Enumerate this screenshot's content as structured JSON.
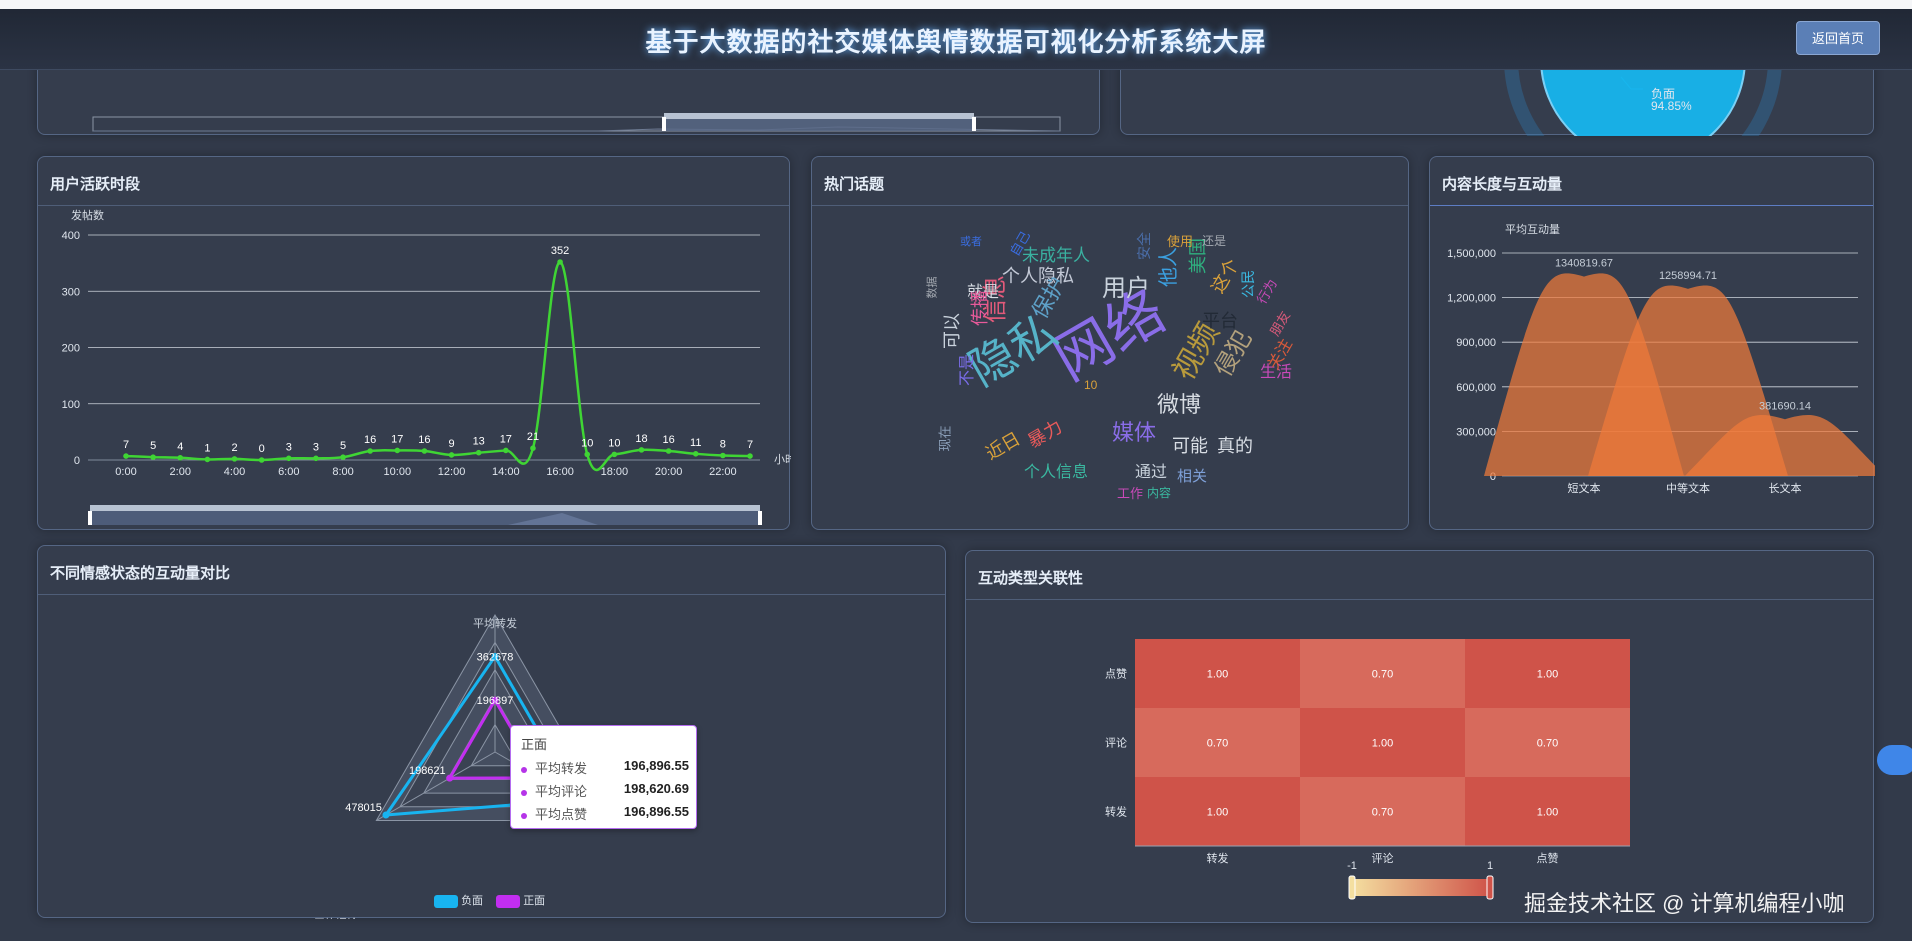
{
  "header": {
    "title": "基于大数据的社交媒体舆情数据可视化分析系统大屏",
    "home_button": "返回首页"
  },
  "sentiment_top": {
    "negative_label": "负面",
    "negative_value": "94.85%"
  },
  "activity_panel": {
    "title": "用户活跃时段",
    "chart_data": {
      "type": "line",
      "ylabel": "发帖数",
      "xlabel": "小时",
      "ylim": [
        0,
        400
      ],
      "yticks": [
        0,
        100,
        200,
        300,
        400
      ],
      "x": [
        "0:00",
        "1:00",
        "2:00",
        "3:00",
        "4:00",
        "5:00",
        "6:00",
        "7:00",
        "8:00",
        "9:00",
        "10:00",
        "11:00",
        "12:00",
        "13:00",
        "14:00",
        "15:00",
        "16:00",
        "17:00",
        "18:00",
        "19:00",
        "20:00",
        "21:00",
        "22:00",
        "23:00"
      ],
      "xtick_labels": [
        "0:00",
        "2:00",
        "4:00",
        "6:00",
        "8:00",
        "10:00",
        "12:00",
        "14:00",
        "16:00",
        "18:00",
        "20:00",
        "22:00"
      ],
      "values": [
        7,
        5,
        4,
        1,
        2,
        0,
        3,
        3,
        5,
        16,
        17,
        16,
        9,
        13,
        17,
        21,
        352,
        10,
        10,
        18,
        16,
        11,
        8,
        7
      ],
      "color": "#3fd534"
    }
  },
  "topics_panel": {
    "title": "热门话题",
    "words": [
      {
        "text": "网络",
        "color": "#8a6de8"
      },
      {
        "text": "隐私",
        "color": "#56b3c8"
      },
      {
        "text": "视频",
        "color": "#b89a3c"
      },
      {
        "text": "用户",
        "color": "#c9d2dc"
      },
      {
        "text": "微博",
        "color": "#d8dde3"
      },
      {
        "text": "侵犯",
        "color": "#b3a17c"
      },
      {
        "text": "保护",
        "color": "#5ea1c8"
      },
      {
        "text": "信息",
        "color": "#e25a7a"
      },
      {
        "text": "个人隐私",
        "color": "#c3c9d6"
      },
      {
        "text": "未成年人",
        "color": "#3ab0a0"
      },
      {
        "text": "就是",
        "color": "#d9dee5"
      },
      {
        "text": "媒体",
        "color": "#8a6de8"
      },
      {
        "text": "可能",
        "color": "#d9dee5"
      },
      {
        "text": "真的",
        "color": "#d9dee5"
      },
      {
        "text": "平台",
        "color": "#222a36"
      },
      {
        "text": "美国",
        "color": "#2fb07f"
      },
      {
        "text": "他人",
        "color": "#3ba0e0"
      },
      {
        "text": "这个",
        "color": "#d9a13a"
      },
      {
        "text": "个人信息",
        "color": "#3ab8a0"
      },
      {
        "text": "通过",
        "color": "#c9d2dc"
      },
      {
        "text": "相关",
        "color": "#7ea0d8"
      },
      {
        "text": "近日",
        "color": "#d9a13a"
      },
      {
        "text": "暴力",
        "color": "#e85a5a"
      },
      {
        "text": "传播",
        "color": "#e85a9a"
      },
      {
        "text": "可以",
        "color": "#c9d2dc"
      },
      {
        "text": "生活",
        "color": "#c84ab8"
      },
      {
        "text": "关注",
        "color": "#d85a3a"
      },
      {
        "text": "公民",
        "color": "#3ab8e0"
      },
      {
        "text": "使用",
        "color": "#d9a13a"
      },
      {
        "text": "安全",
        "color": "#4a6da8"
      },
      {
        "text": "还是",
        "color": "#a3a8b0"
      },
      {
        "text": "或者",
        "color": "#3a6de0"
      },
      {
        "text": "数据",
        "color": "#a3a8b0"
      },
      {
        "text": "工作",
        "color": "#c84ab8"
      },
      {
        "text": "内容",
        "color": "#3ab8a0"
      },
      {
        "text": "现在",
        "color": "#8a9eb8"
      },
      {
        "text": "不是",
        "color": "#7a6de8"
      },
      {
        "text": "行为",
        "color": "#c84ab8"
      },
      {
        "text": "朋友",
        "color": "#d85a7a"
      },
      {
        "text": "自己",
        "color": "#3a6de0"
      }
    ],
    "number_mark": "10"
  },
  "length_panel": {
    "title": "内容长度与互动量",
    "chart_data": {
      "type": "area",
      "ylabel": "平均互动量",
      "categories": [
        "短文本",
        "中等文本",
        "长文本"
      ],
      "values": [
        1340819.67,
        1258994.71,
        381690.14
      ],
      "value_labels": [
        "1340819.67",
        "1258994.71",
        "381690.14"
      ],
      "yticks": [
        "0",
        "300,000",
        "600,000",
        "900,000",
        "1,200,000",
        "1,500,000"
      ],
      "ylim": [
        0,
        1500000
      ],
      "color": "#f07a3a"
    }
  },
  "radar_panel": {
    "title": "不同情感状态的互动量对比",
    "chart_data": {
      "type": "radar",
      "indicators": [
        "平均转发",
        "平均评论",
        "平均点赞"
      ],
      "series": [
        {
          "name": "负面",
          "values": [
            362678,
            478015,
            362678
          ],
          "labels": [
            "362678",
            "478015"
          ],
          "color": "#18b4f0"
        },
        {
          "name": "正面",
          "values": [
            196897,
            198621,
            196897
          ],
          "labels": [
            "196897",
            "198621"
          ],
          "color": "#c22ef0"
        }
      ]
    },
    "tooltip": {
      "title": "正面",
      "rows": [
        {
          "label": "平均转发",
          "value": "196,896.55"
        },
        {
          "label": "平均评论",
          "value": "198,620.69"
        },
        {
          "label": "平均点赞",
          "value": "196,896.55"
        }
      ]
    },
    "legend": [
      "负面",
      "正面"
    ]
  },
  "heatmap_panel": {
    "title": "互动类型关联性",
    "chart_data": {
      "type": "heatmap",
      "x_categories": [
        "转发",
        "评论",
        "点赞"
      ],
      "y_categories": [
        "点赞",
        "评论",
        "转发"
      ],
      "values": [
        [
          "1.00",
          "0.70",
          "1.00"
        ],
        [
          "0.70",
          "1.00",
          "0.70"
        ],
        [
          "1.00",
          "0.70",
          "1.00"
        ]
      ],
      "scale_min": "-1",
      "scale_max": "1",
      "high_color": "#cf5349",
      "mid_color": "#d76a5c"
    }
  },
  "watermark": "掘金技术社区 @ 计算机编程小咖"
}
